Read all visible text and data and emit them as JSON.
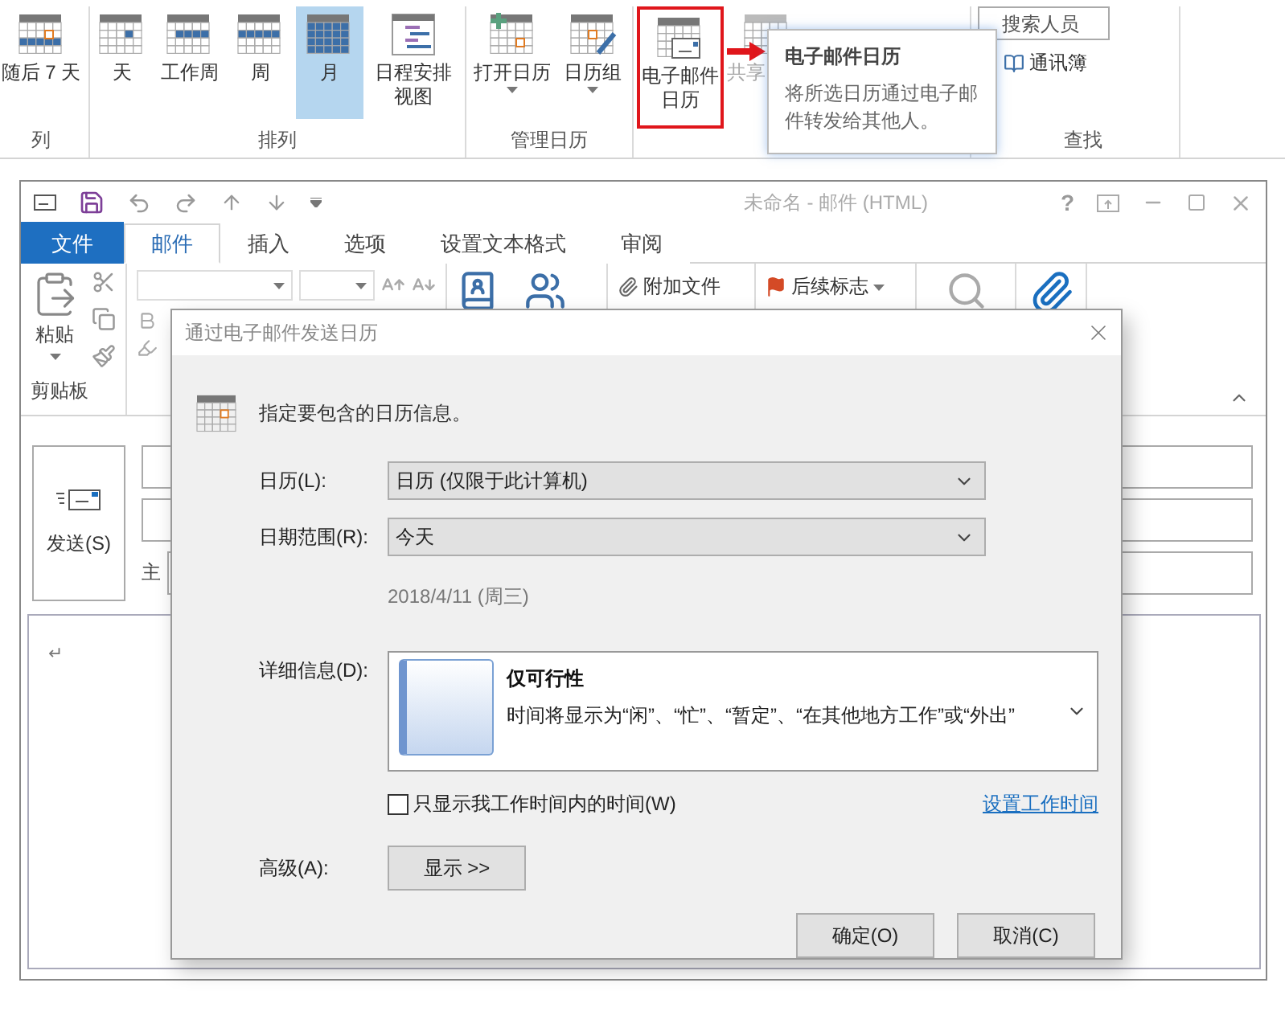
{
  "calendar_ribbon": {
    "groups": [
      {
        "label": "列",
        "items": [
          {
            "label": "随后 7 天",
            "selected": false
          }
        ]
      },
      {
        "label": "排列",
        "items": [
          {
            "label": "天",
            "selected": false
          },
          {
            "label": "工作周",
            "selected": false
          },
          {
            "label": "周",
            "selected": false
          },
          {
            "label": "月",
            "selected": true
          },
          {
            "label": "日程安排视图",
            "selected": false
          }
        ]
      },
      {
        "label": "管理日历",
        "items": [
          {
            "label": "打开日历",
            "dropdown": true
          },
          {
            "label": "日历组",
            "dropdown": true
          }
        ]
      },
      {
        "items": [
          {
            "label": "电子邮件日历",
            "highlighted": true
          },
          {
            "label": "共享",
            "disabled": true
          }
        ]
      },
      {
        "label": "查找",
        "search": {
          "placeholder": "搜索人员"
        },
        "items": [
          {
            "label": "通讯簿"
          }
        ]
      }
    ]
  },
  "tooltip": {
    "title": "电子邮件日历",
    "text": "将所选日历通过电子邮件转发给其他人。"
  },
  "compose_window": {
    "title": "未命名 - 邮件 (HTML)",
    "help": "?",
    "tabs": [
      {
        "label": "文件",
        "selected": false,
        "kind": "backstage"
      },
      {
        "label": "邮件",
        "selected": true,
        "kind": "tab"
      },
      {
        "label": "插入",
        "selected": false,
        "kind": "tab"
      },
      {
        "label": "选项",
        "selected": false,
        "kind": "tab"
      },
      {
        "label": "设置文本格式",
        "selected": false,
        "kind": "tab"
      },
      {
        "label": "审阅",
        "selected": false,
        "kind": "tab"
      }
    ],
    "ribbon": {
      "paste": "粘贴",
      "clipboard_group": "剪贴板",
      "attach_file": "附加文件",
      "follow_up": "后续标志"
    },
    "send": "发送(S)",
    "subject_label": "主",
    "paragraph_mark": "↵"
  },
  "dialog": {
    "title": "通过电子邮件发送日历",
    "intro": "指定要包含的日历信息。",
    "fields": [
      {
        "label": "日历(L):",
        "value": "日历 (仅限于此计算机)"
      },
      {
        "label": "日期范围(R):",
        "value": "今天"
      }
    ],
    "date": "2018/4/11 (周三)",
    "details": {
      "label": "详细信息(D):",
      "title": "仅可行性",
      "description": "时间将显示为“闲”、“忙”、“暂定”、“在其他地方工作”或“外出”"
    },
    "working_hours_only": {
      "label": "只显示我工作时间内的时间(W)",
      "checked": false
    },
    "link": "设置工作时间",
    "advanced": {
      "label": "高级(A):",
      "button": "显示 >>"
    },
    "buttons": [
      "确定(O)",
      "取消(C)"
    ]
  }
}
